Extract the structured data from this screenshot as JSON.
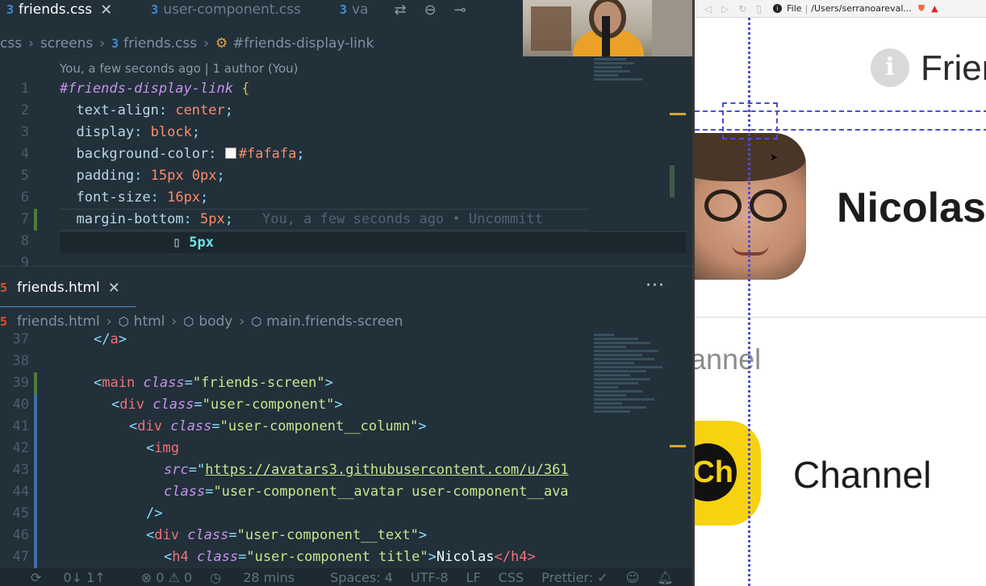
{
  "editor": {
    "top_tabs": [
      {
        "label": "friends.css",
        "icon": "css-icon",
        "active": true
      },
      {
        "label": "user-component.css",
        "icon": "css-icon",
        "active": false
      },
      {
        "label": "va",
        "icon": "css-icon",
        "active": false
      }
    ],
    "top_breadcrumb": [
      "css",
      "screens",
      "friends.css",
      "#friends-display-link"
    ],
    "codelens": "You, a few seconds ago | 1 author (You)",
    "css_lines": [
      {
        "num": "1",
        "selector": "#friends-display-link",
        "brace": "{"
      },
      {
        "num": "2",
        "prop": "text-align",
        "value": "center"
      },
      {
        "num": "3",
        "prop": "display",
        "value": "block"
      },
      {
        "num": "4",
        "prop": "background-color",
        "value": "#fafafa"
      },
      {
        "num": "5",
        "prop": "padding",
        "value": "15px 0px"
      },
      {
        "num": "6",
        "prop": "font-size",
        "value": "16px"
      },
      {
        "num": "7",
        "prop": "margin-bottom",
        "value": "5px",
        "blame": "You, a few seconds ago • Uncommitt"
      },
      {
        "num": "8",
        "brace": "}"
      },
      {
        "num": "9"
      }
    ],
    "hover_hint": "5px",
    "bottom_tab": {
      "label": "friends.html",
      "icon": "html-icon"
    },
    "bottom_breadcrumb": [
      "friends.html",
      "html",
      "body",
      "main.friends-screen"
    ],
    "html_line_numbers": [
      "37",
      "38",
      "39",
      "40",
      "41",
      "42",
      "43",
      "44",
      "45",
      "46",
      "47"
    ],
    "html_lines": {
      "l37": "</a>",
      "l39_tag": "main",
      "l39_attr": "class",
      "l39_val": "\"friends-screen\"",
      "l40_tag": "div",
      "l40_attr": "class",
      "l40_val": "\"user-component\"",
      "l41_tag": "div",
      "l41_attr": "class",
      "l41_val": "\"user-component__column\"",
      "l42_tag": "img",
      "l43_attr": "src",
      "l43_val": "https://avatars3.githubusercontent.com/u/361",
      "l44_attr": "class",
      "l44_val": "\"user-component__avatar user-component__ava",
      "l45": "/>",
      "l46_tag": "div",
      "l46_attr": "class",
      "l46_val": "\"user-component__text\"",
      "l47_tag": "h4",
      "l47_attr": "class",
      "l47_val": "\"user-component  title\"",
      "l47_text": "Nicolas",
      "l47_close": "</h4>"
    },
    "more_actions": "···",
    "statusbar": {
      "sync": "0↓ 1↑",
      "problems": "⊗ 0 ⚠ 0",
      "time": "28 mins",
      "spaces": "Spaces: 4",
      "encoding": "UTF-8",
      "eol": "LF",
      "language": "CSS",
      "formatter": "Prettier: ✓"
    }
  },
  "browser": {
    "address_label": "File",
    "address_path": "/Users/serranoareval...",
    "header_title": "Frier",
    "user_name": "Nicolas",
    "section_label": "annel",
    "channel_initials": "Ch",
    "channel_name": "Channel"
  }
}
